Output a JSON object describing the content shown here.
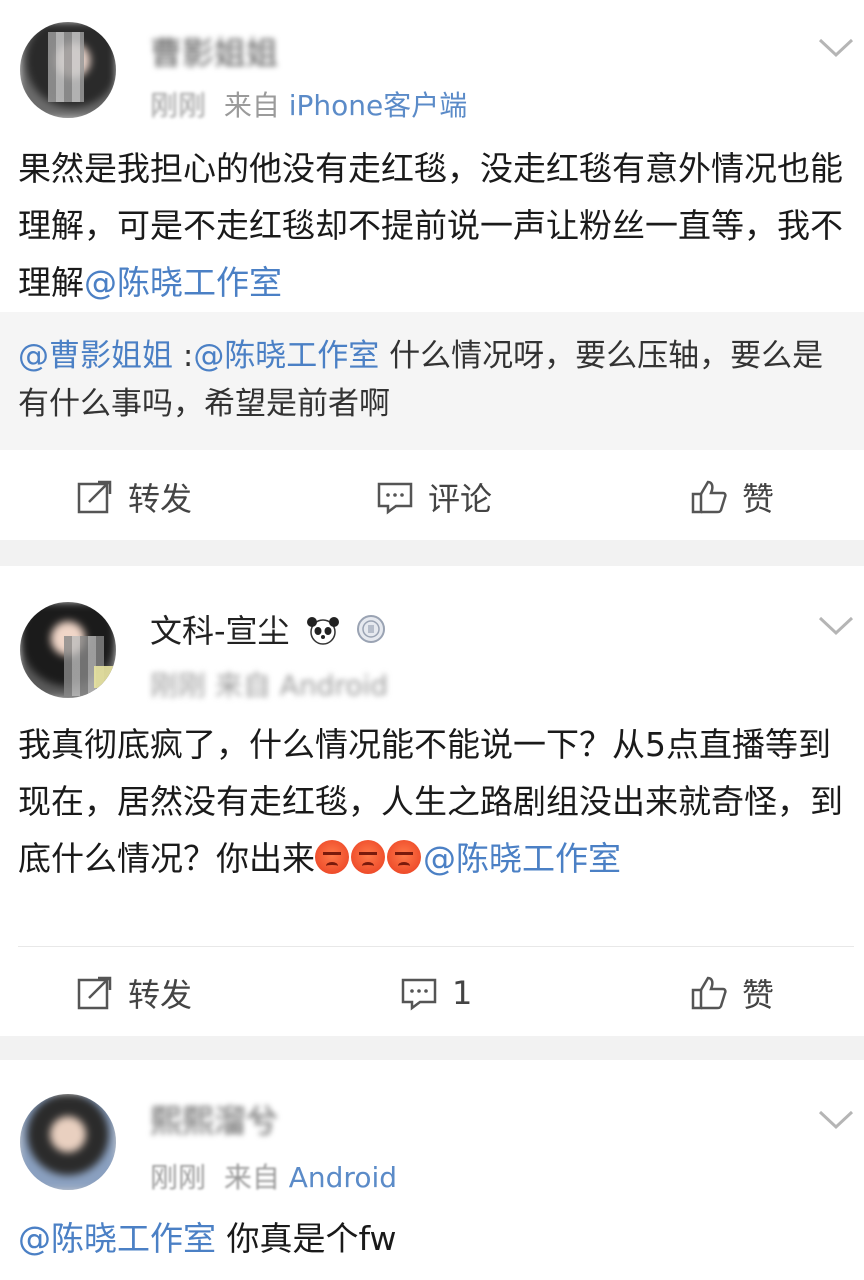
{
  "posts": [
    {
      "user": "曹影姐姐",
      "time": "刚刚",
      "source_prefix": "来自",
      "source": "iPhone客户端",
      "text_before": "果然是我担心的他没有走红毯，没走红毯有意外情况也能理解，可是不走红毯却不提前说一声让粉丝一直等，我不理解",
      "mention": "@陈晓工作室",
      "repost": {
        "mention1": "@曹影姐姐",
        "sep": " :",
        "mention2": "@陈晓工作室",
        "text": " 什么情况呀，要么压轴，要么是有什么事吗，希望是前者啊"
      },
      "actions": {
        "repost": "转发",
        "comment": "评论",
        "like": "赞"
      }
    },
    {
      "user": "文科-宣尘",
      "user_icons": [
        "panda-icon",
        "medal-icon"
      ],
      "meta_blurred": "刚刚 来自 Android",
      "text_before": "我真彻底疯了，什么情况能不能说一下？从5点直播等到现在，居然没有走红毯，人生之路剧组没出来就奇怪，到底什么情况？你出来",
      "emojis": [
        "angry-emoji",
        "angry-emoji",
        "angry-emoji"
      ],
      "mention": "@陈晓工作室",
      "actions": {
        "repost": "转发",
        "comment": "1",
        "like": "赞"
      }
    },
    {
      "user": "熙熙溜兮",
      "time": "刚刚",
      "source_prefix": "来自",
      "source": "Android",
      "mention": "@陈晓工作室",
      "text_after": " 你真是个fw"
    }
  ],
  "colors": {
    "mention": "#4b80c5",
    "meta": "#9b9b9b",
    "separator": "#f2f2f2",
    "repost_bg": "#f5f5f5"
  }
}
